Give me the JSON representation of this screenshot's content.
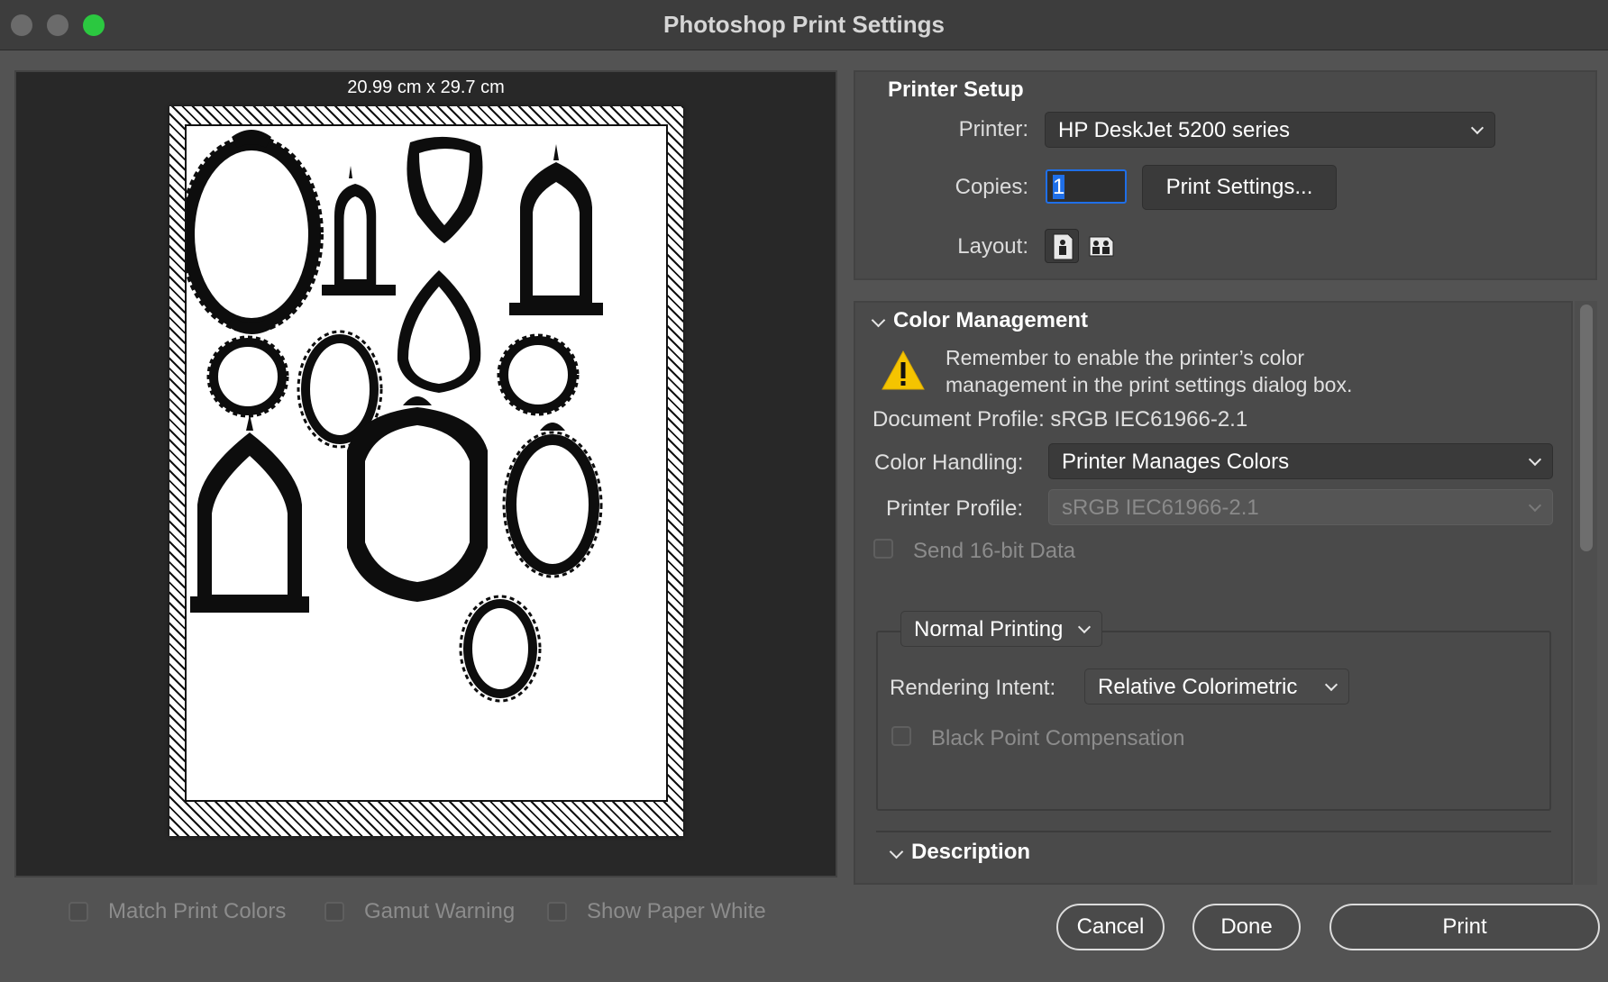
{
  "window": {
    "title": "Photoshop Print Settings"
  },
  "preview": {
    "paper_size": "20.99 cm x 29.7 cm",
    "options": [
      {
        "label": "Match Print Colors",
        "checked": false
      },
      {
        "label": "Gamut Warning",
        "checked": false
      },
      {
        "label": "Show Paper White",
        "checked": false
      }
    ]
  },
  "printer_setup": {
    "title": "Printer Setup",
    "printer_label": "Printer:",
    "printer_value": "HP DeskJet 5200 series",
    "copies_label": "Copies:",
    "copies_value": "1",
    "print_settings_button": "Print Settings...",
    "layout_label": "Layout:",
    "layout_selected": "portrait"
  },
  "color_management": {
    "title": "Color Management",
    "warning": "Remember to enable the printer’s color management in the print settings dialog box.",
    "warning_line1": "Remember to enable the printer’s color",
    "warning_line2": "management in the print settings dialog box.",
    "document_profile": "Document Profile: sRGB IEC61966-2.1",
    "color_handling_label": "Color Handling:",
    "color_handling_value": "Printer Manages Colors",
    "printer_profile_label": "Printer Profile:",
    "printer_profile_value": "sRGB IEC61966-2.1",
    "send_16bit_label": "Send 16-bit Data",
    "printing_mode": "Normal Printing",
    "rendering_intent_label": "Rendering Intent:",
    "rendering_intent_value": "Relative Colorimetric",
    "black_point_label": "Black Point Compensation"
  },
  "description": {
    "title": "Description"
  },
  "buttons": {
    "cancel": "Cancel",
    "done": "Done",
    "print": "Print"
  },
  "colors": {
    "accent": "#1f6fe8",
    "maximize": "#2bc840",
    "warning": "#f5c400"
  }
}
